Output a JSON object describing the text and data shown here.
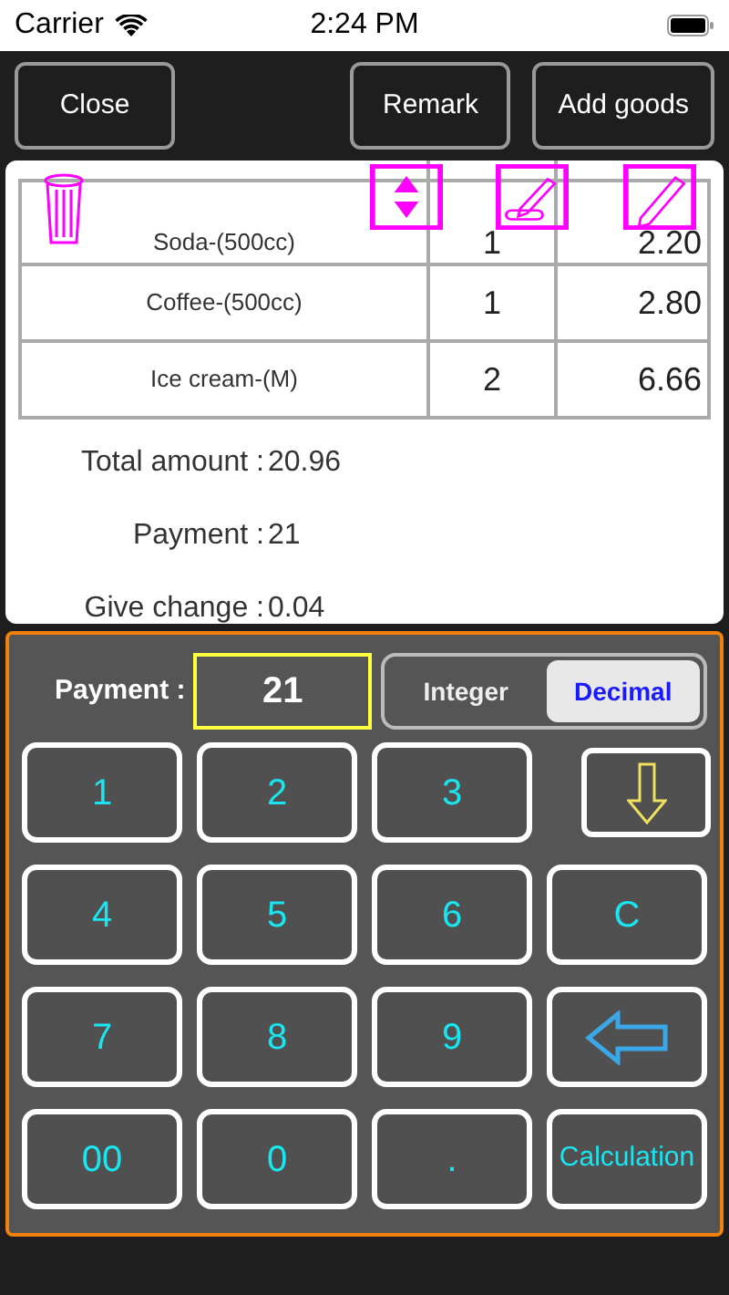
{
  "status_bar": {
    "carrier": "Carrier",
    "time": "2:24 PM"
  },
  "toolbar": {
    "buttons": [
      "Close",
      "Remark",
      "Add goods"
    ]
  },
  "order_table": {
    "rows": [
      {
        "name": "Soda-(500cc)",
        "quantity": "1",
        "price": "2.20"
      },
      {
        "name": "Coffee-(500cc)",
        "quantity": "1",
        "price": "2.80"
      },
      {
        "name": "Ice cream-(M)",
        "quantity": "2",
        "price": "6.66"
      }
    ]
  },
  "totals": [
    {
      "label": "Total amount :",
      "value": "20.96"
    },
    {
      "label": "Payment :",
      "value": "21"
    },
    {
      "label": "Give change :",
      "value": "0.04"
    }
  ],
  "keypad": {
    "payment_label": "Payment :",
    "payment_value": "21",
    "modes": [
      {
        "label": "Integer",
        "selected": false
      },
      {
        "label": "Decimal",
        "selected": true
      }
    ],
    "keys": [
      {
        "kind": "text",
        "label": "1"
      },
      {
        "kind": "text",
        "label": "2"
      },
      {
        "kind": "text",
        "label": "3"
      },
      {
        "kind": "down"
      },
      {
        "kind": "text",
        "label": "4"
      },
      {
        "kind": "text",
        "label": "5"
      },
      {
        "kind": "text",
        "label": "6"
      },
      {
        "kind": "text",
        "label": "C"
      },
      {
        "kind": "text",
        "label": "7"
      },
      {
        "kind": "text",
        "label": "8"
      },
      {
        "kind": "text",
        "label": "9"
      },
      {
        "kind": "back"
      },
      {
        "kind": "text",
        "label": "00"
      },
      {
        "kind": "text",
        "label": "0"
      },
      {
        "kind": "text",
        "label": "."
      },
      {
        "kind": "text",
        "label": "Calculation"
      }
    ]
  }
}
